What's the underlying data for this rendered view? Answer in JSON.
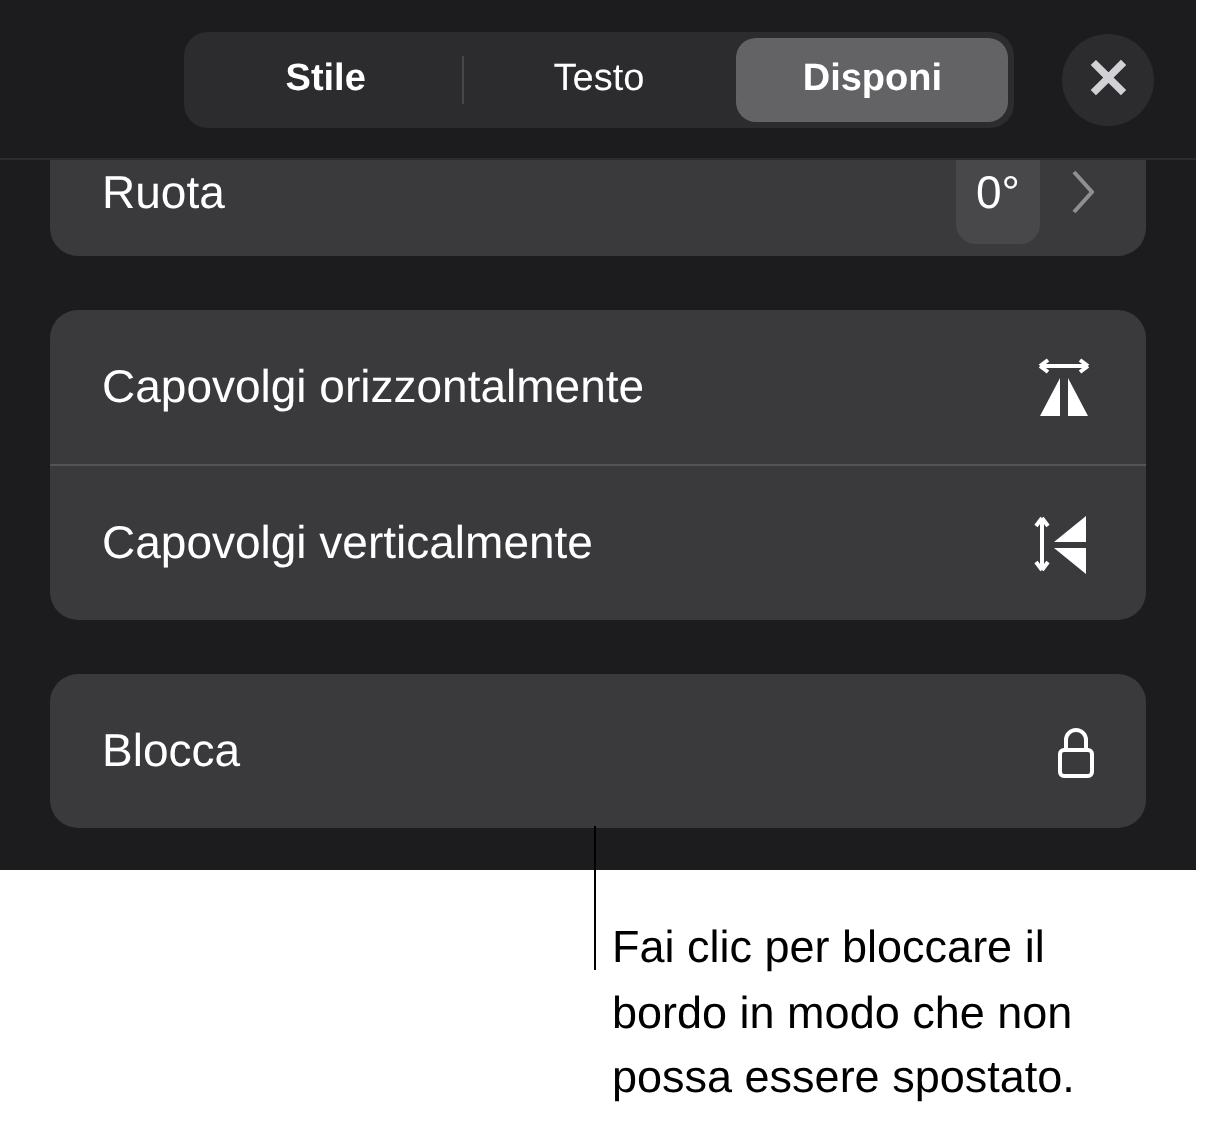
{
  "tabs": [
    {
      "label": "Stile",
      "selected": false
    },
    {
      "label": "Testo",
      "selected": false
    },
    {
      "label": "Disponi",
      "selected": true
    }
  ],
  "close_button": {
    "label": "✕"
  },
  "groups": [
    {
      "rows": [
        {
          "kind": "rotate",
          "label": "Ruota",
          "value": "0°"
        }
      ]
    },
    {
      "rows": [
        {
          "kind": "flip-horizontal",
          "label": "Capovolgi orizzontalmente"
        },
        {
          "kind": "flip-vertical",
          "label": "Capovolgi verticalmente"
        }
      ]
    },
    {
      "rows": [
        {
          "kind": "lock",
          "label": "Blocca"
        }
      ]
    }
  ],
  "callout": {
    "lines": [
      "Fai clic per bloccare il",
      "bordo in modo che non",
      "possa essere spostato."
    ]
  }
}
